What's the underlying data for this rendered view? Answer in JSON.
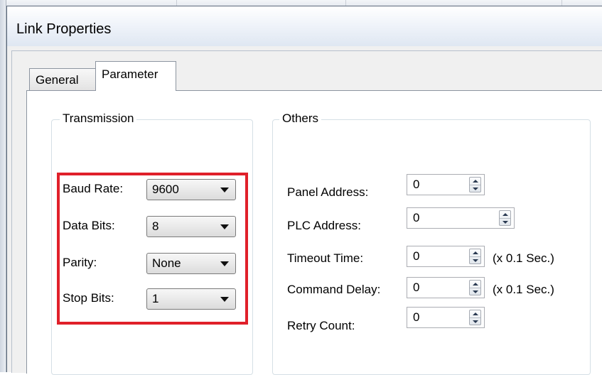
{
  "dialog": {
    "title": "Link Properties"
  },
  "tabs": [
    {
      "label": "General",
      "active": false
    },
    {
      "label": "Parameter",
      "active": true
    }
  ],
  "transmission": {
    "title": "Transmission",
    "fields": [
      {
        "label": "Baud Rate:",
        "value": "9600"
      },
      {
        "label": "Data Bits:",
        "value": "8"
      },
      {
        "label": "Parity:",
        "value": "None"
      },
      {
        "label": "Stop Bits:",
        "value": "1"
      }
    ]
  },
  "others": {
    "title": "Others",
    "fields": [
      {
        "label": "Panel Address:",
        "value": "0",
        "unit": ""
      },
      {
        "label": "PLC Address:",
        "value": "0",
        "unit": ""
      },
      {
        "label": "Timeout Time:",
        "value": "0",
        "unit": "(x 0.1 Sec.)"
      },
      {
        "label": "Command Delay:",
        "value": "0",
        "unit": "(x 0.1 Sec.)"
      },
      {
        "label": "Retry Count:",
        "value": "0",
        "unit": ""
      }
    ]
  },
  "colors": {
    "highlight": "#e0202a",
    "titlebar": "#dfe7f2",
    "panel": "#ffffff"
  },
  "icons": {
    "dropdown": "chevron-down-icon",
    "spinner": "spin-arrows-icon"
  }
}
